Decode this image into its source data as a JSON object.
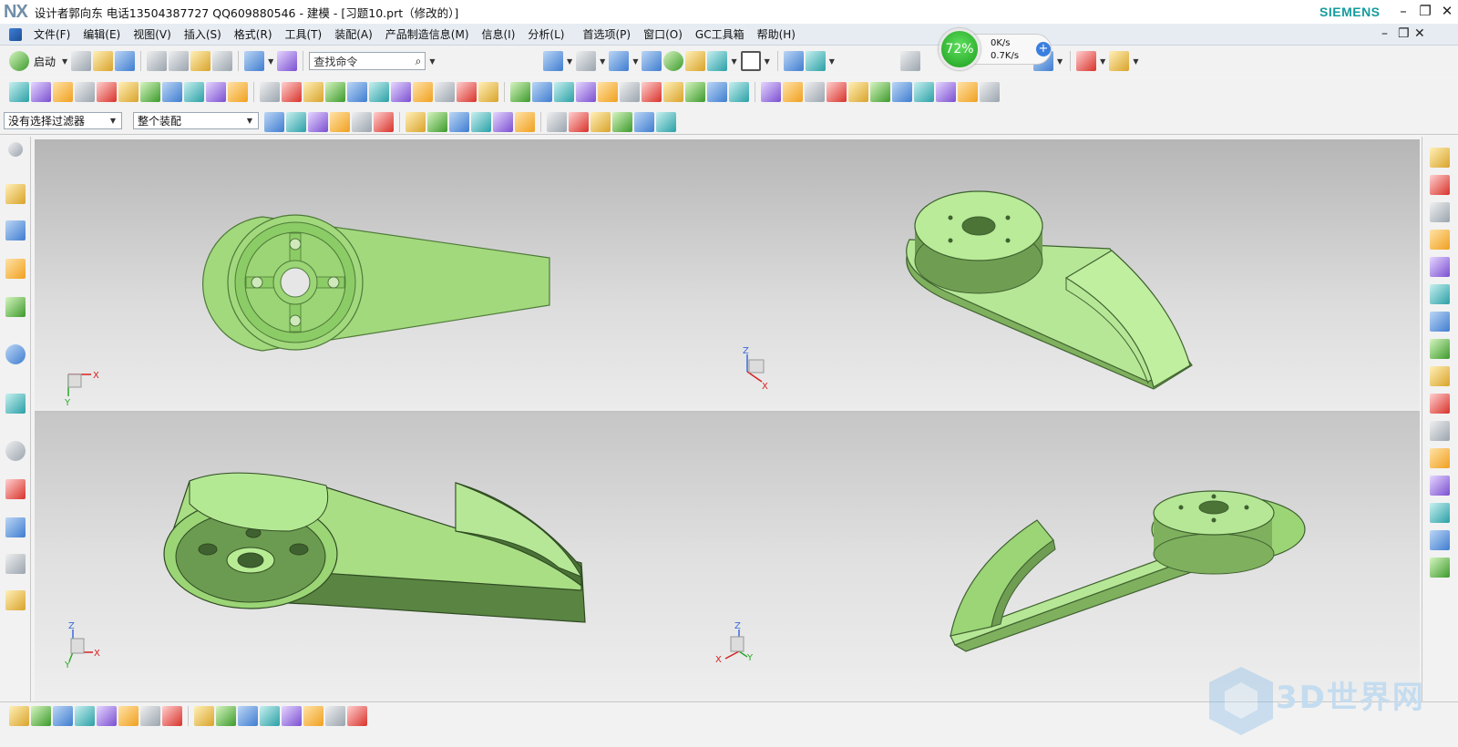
{
  "titlebar": {
    "logo": "NX",
    "title": "设计者郭向东  电话13504387727  QQ609880546 - 建模 - [习题10.prt（修改的）]",
    "brand": "SIEMENS",
    "minimize": "–",
    "restore": "❐",
    "close": "✕"
  },
  "menubar": {
    "items": [
      "文件(F)",
      "编辑(E)",
      "视图(V)",
      "插入(S)",
      "格式(R)",
      "工具(T)",
      "装配(A)",
      "产品制造信息(M)",
      "信息(I)",
      "分析(L)",
      "首选项(P)",
      "窗口(O)",
      "GC工具箱",
      "帮助(H)"
    ],
    "minimize": "–",
    "restore": "❐",
    "close": "✕"
  },
  "toolbar1": {
    "start_label": "启动",
    "search_placeholder": "查找命令"
  },
  "netwidget": {
    "percent": "72%",
    "up_speed": "0K/s",
    "down_speed": "0.7K/s"
  },
  "selection_bar": {
    "filter_value": "没有选择过滤器",
    "scope_value": "整个装配"
  },
  "triads": [
    {
      "x": "X",
      "y": "Y"
    },
    {
      "z": "Z",
      "x": "X"
    },
    {
      "z": "Z",
      "x": "X",
      "y": "Y"
    },
    {
      "z": "Z",
      "x": "X",
      "y": "Y"
    }
  ],
  "watermark": "3D世界网",
  "colors": {
    "model_green": "#9fd67c",
    "model_dark": "#5e8c45",
    "menubar_bg": "#e6ecf2",
    "siemens": "#149c9c"
  }
}
